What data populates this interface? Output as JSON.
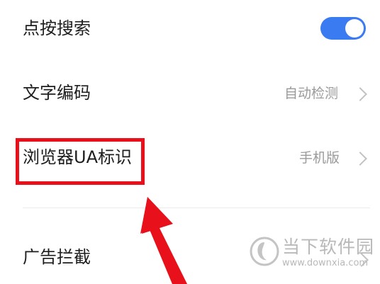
{
  "settings": {
    "items": [
      {
        "label": "点按搜索",
        "toggle_on": true
      },
      {
        "label": "文字编码",
        "value": "自动检测"
      },
      {
        "label": "浏览器UA标识",
        "value": "手机版"
      },
      {
        "label": "广告拦截"
      }
    ]
  },
  "watermark": {
    "title": "当下软件园",
    "url": "www.downxia.com"
  },
  "colors": {
    "toggle_on": "#3b7bf2",
    "highlight": "#e8101a",
    "watermark": "#b9b9b9"
  },
  "icons": {
    "chevron": "chevron-right-icon",
    "annotation_arrow": "arrow-pointer-icon",
    "watermark_logo": "downxia-logo-icon"
  }
}
